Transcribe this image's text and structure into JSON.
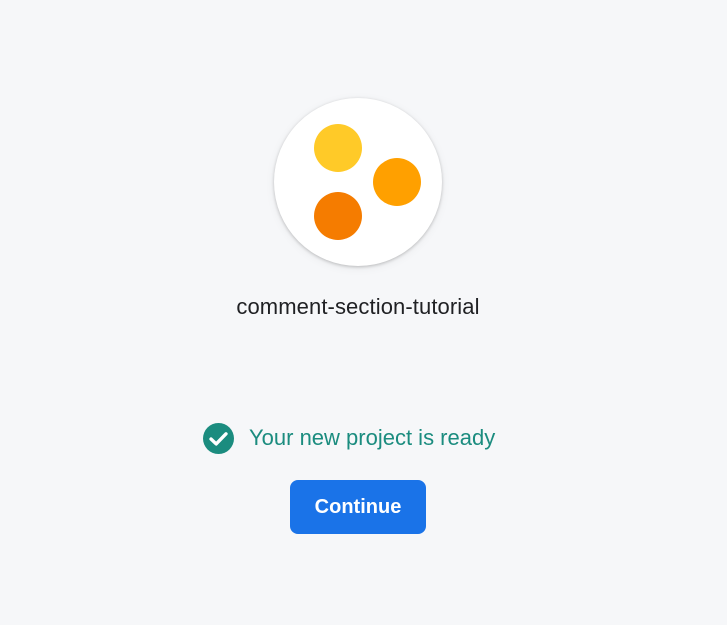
{
  "project": {
    "name": "comment-section-tutorial",
    "logo_icon": "three-dots-logo-icon"
  },
  "status": {
    "icon": "check-circle-icon",
    "message": "Your new project is ready"
  },
  "actions": {
    "continue_label": "Continue"
  },
  "colors": {
    "background": "#f6f7f9",
    "dot_yellow": "#ffca28",
    "dot_amber": "#ffa000",
    "dot_orange": "#f57c00",
    "success": "#1b8c7f",
    "primary": "#1a73e8"
  }
}
